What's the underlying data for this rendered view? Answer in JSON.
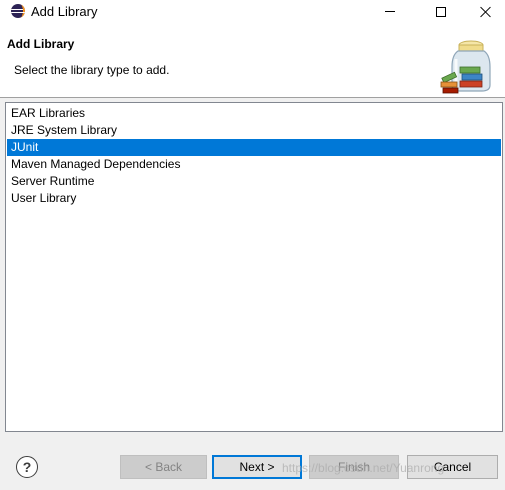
{
  "window": {
    "title": "Add Library"
  },
  "banner": {
    "title": "Add Library",
    "description": "Select the library type to add."
  },
  "library_types": [
    {
      "label": "EAR Libraries",
      "selected": false
    },
    {
      "label": "JRE System Library",
      "selected": false
    },
    {
      "label": "JUnit",
      "selected": true
    },
    {
      "label": "Maven Managed Dependencies",
      "selected": false
    },
    {
      "label": "Server Runtime",
      "selected": false
    },
    {
      "label": "User Library",
      "selected": false
    }
  ],
  "buttons": {
    "help": "?",
    "back": "< Back",
    "next": "Next >",
    "finish": "Finish",
    "cancel": "Cancel"
  },
  "watermark": "https://blog.csdn.net/Yuanrong",
  "colors": {
    "selection": "#0078d7",
    "default_button_border": "#0078d7",
    "window_background": "#f0f0f0"
  }
}
